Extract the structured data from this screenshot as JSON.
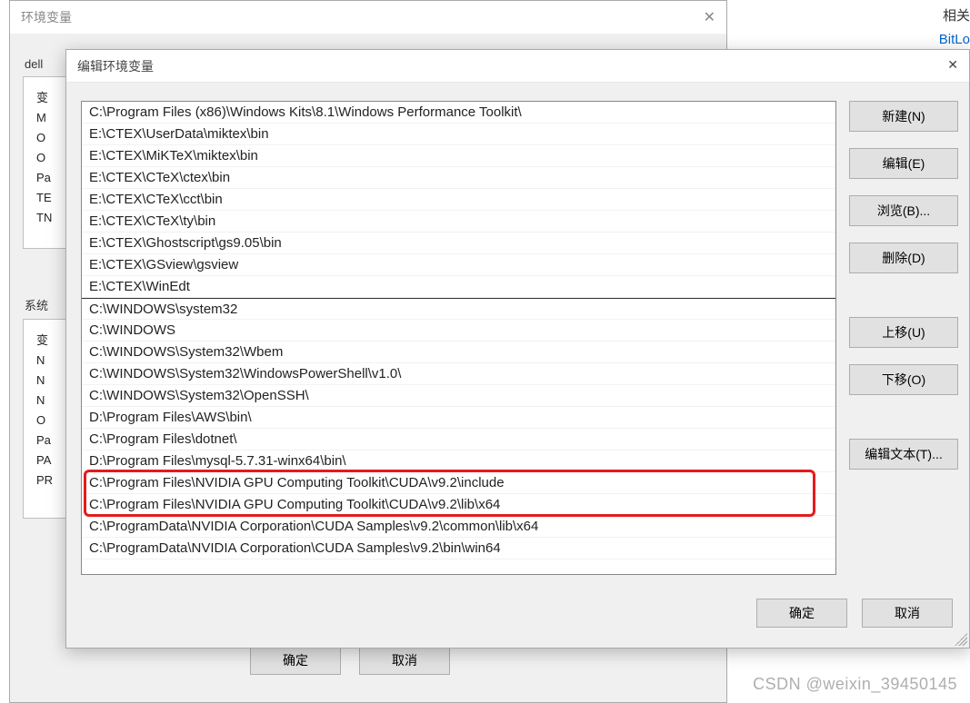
{
  "side": {
    "heading": "相关",
    "link": "BitLo"
  },
  "bgWindow": {
    "title": "环境变量",
    "userLabel": "dell ",
    "userFrame": {
      "col1": "变",
      "rows": [
        "M",
        "O",
        "O",
        "Pa",
        "TE",
        "TN"
      ]
    },
    "sysLabel": "系统",
    "sysFrame": {
      "col1": "变",
      "rows": [
        "N",
        "N",
        "N",
        "O",
        "Pa",
        "PA",
        "PR",
        ""
      ]
    },
    "ok": "确定",
    "cancel": "取消"
  },
  "fgWindow": {
    "title": "编辑环境变量",
    "items": [
      "C:\\Program Files (x86)\\Windows Kits\\8.1\\Windows Performance Toolkit\\",
      "E:\\CTEX\\UserData\\miktex\\bin",
      "E:\\CTEX\\MiKTeX\\miktex\\bin",
      "E:\\CTEX\\CTeX\\ctex\\bin",
      "E:\\CTEX\\CTeX\\cct\\bin",
      "E:\\CTEX\\CTeX\\ty\\bin",
      "E:\\CTEX\\Ghostscript\\gs9.05\\bin",
      "E:\\CTEX\\GSview\\gsview",
      "E:\\CTEX\\WinEdt",
      "C:\\WINDOWS\\system32",
      "C:\\WINDOWS",
      "C:\\WINDOWS\\System32\\Wbem",
      "C:\\WINDOWS\\System32\\WindowsPowerShell\\v1.0\\",
      "C:\\WINDOWS\\System32\\OpenSSH\\",
      "D:\\Program Files\\AWS\\bin\\",
      "C:\\Program Files\\dotnet\\",
      "D:\\Program Files\\mysql-5.7.31-winx64\\bin\\",
      "C:\\Program Files\\NVIDIA GPU Computing Toolkit\\CUDA\\v9.2\\include",
      "C:\\Program Files\\NVIDIA GPU Computing Toolkit\\CUDA\\v9.2\\lib\\x64",
      "C:\\ProgramData\\NVIDIA Corporation\\CUDA Samples\\v9.2\\common\\lib\\x64",
      "C:\\ProgramData\\NVIDIA Corporation\\CUDA Samples\\v9.2\\bin\\win64"
    ],
    "highlightStart": 17,
    "highlightEnd": 18,
    "buttons": {
      "new": "新建(N)",
      "edit": "编辑(E)",
      "browse": "浏览(B)...",
      "delete": "删除(D)",
      "moveUp": "上移(U)",
      "moveDown": "下移(O)",
      "editText": "编辑文本(T)..."
    },
    "ok": "确定",
    "cancel": "取消"
  },
  "watermark": "CSDN @weixin_39450145"
}
